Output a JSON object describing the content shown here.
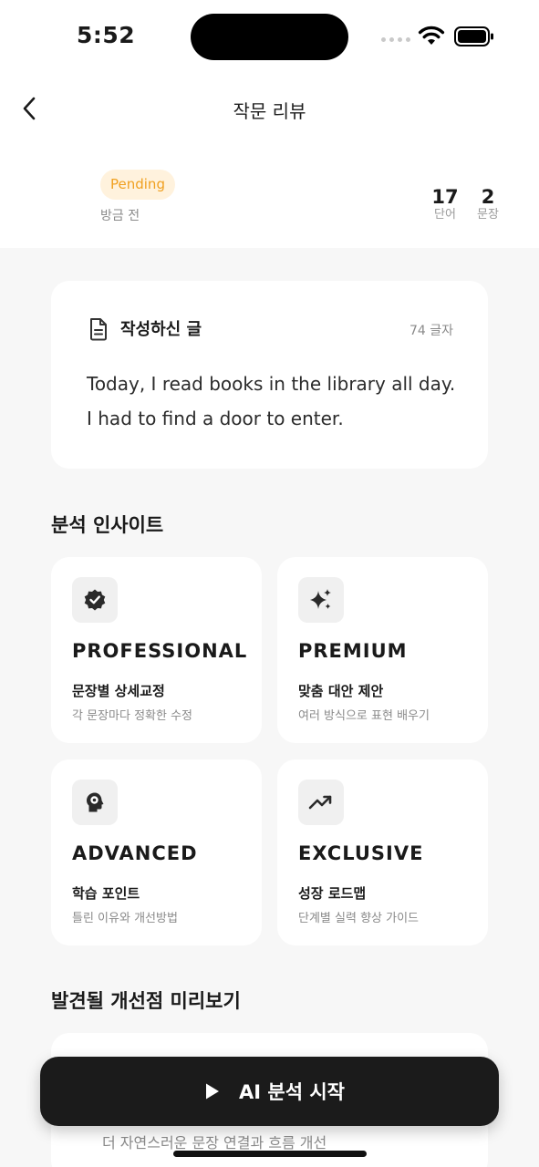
{
  "status_bar": {
    "time": "5:52"
  },
  "header": {
    "title": "작문 리뷰"
  },
  "meta": {
    "status": "Pending",
    "time_ago": "방금 전",
    "words": {
      "value": "17",
      "label": "단어"
    },
    "sentences": {
      "value": "2",
      "label": "문장"
    }
  },
  "essay": {
    "heading": "작성하신 글",
    "char_count": "74 글자",
    "lines": [
      "Today, I read books in the library all day.",
      "I had to find a door to enter."
    ]
  },
  "insights": {
    "title": "분석 인사이트",
    "cards": [
      {
        "icon": "verified-badge-icon",
        "tier": "PROFESSIONAL",
        "feature": "문장별 상세교정",
        "desc": "각 문장마다 정확한 수정"
      },
      {
        "icon": "sparkles-icon",
        "tier": "PREMIUM",
        "feature": "맞춤 대안 제안",
        "desc": "여러 방식으로 표현 배우기"
      },
      {
        "icon": "brain-gear-icon",
        "tier": "ADVANCED",
        "feature": "학습 포인트",
        "desc": "틀린 이유와 개선방법"
      },
      {
        "icon": "trending-up-icon",
        "tier": "EXCLUSIVE",
        "feature": "성장 로드맵",
        "desc": "단계별 실력 향상 가이드"
      }
    ]
  },
  "preview": {
    "title": "발견될 개선점 미리보기",
    "item_text": "더 자연스러운 문장 연결과 흐름 개선"
  },
  "cta": {
    "label": "AI 분석 시작",
    "icon": "play-icon"
  },
  "colors": {
    "badge_bg": "#fff2dd",
    "badge_text": "#f0a020",
    "cta_bg": "#1b1b1b",
    "page_bg": "#f7f7f7"
  }
}
